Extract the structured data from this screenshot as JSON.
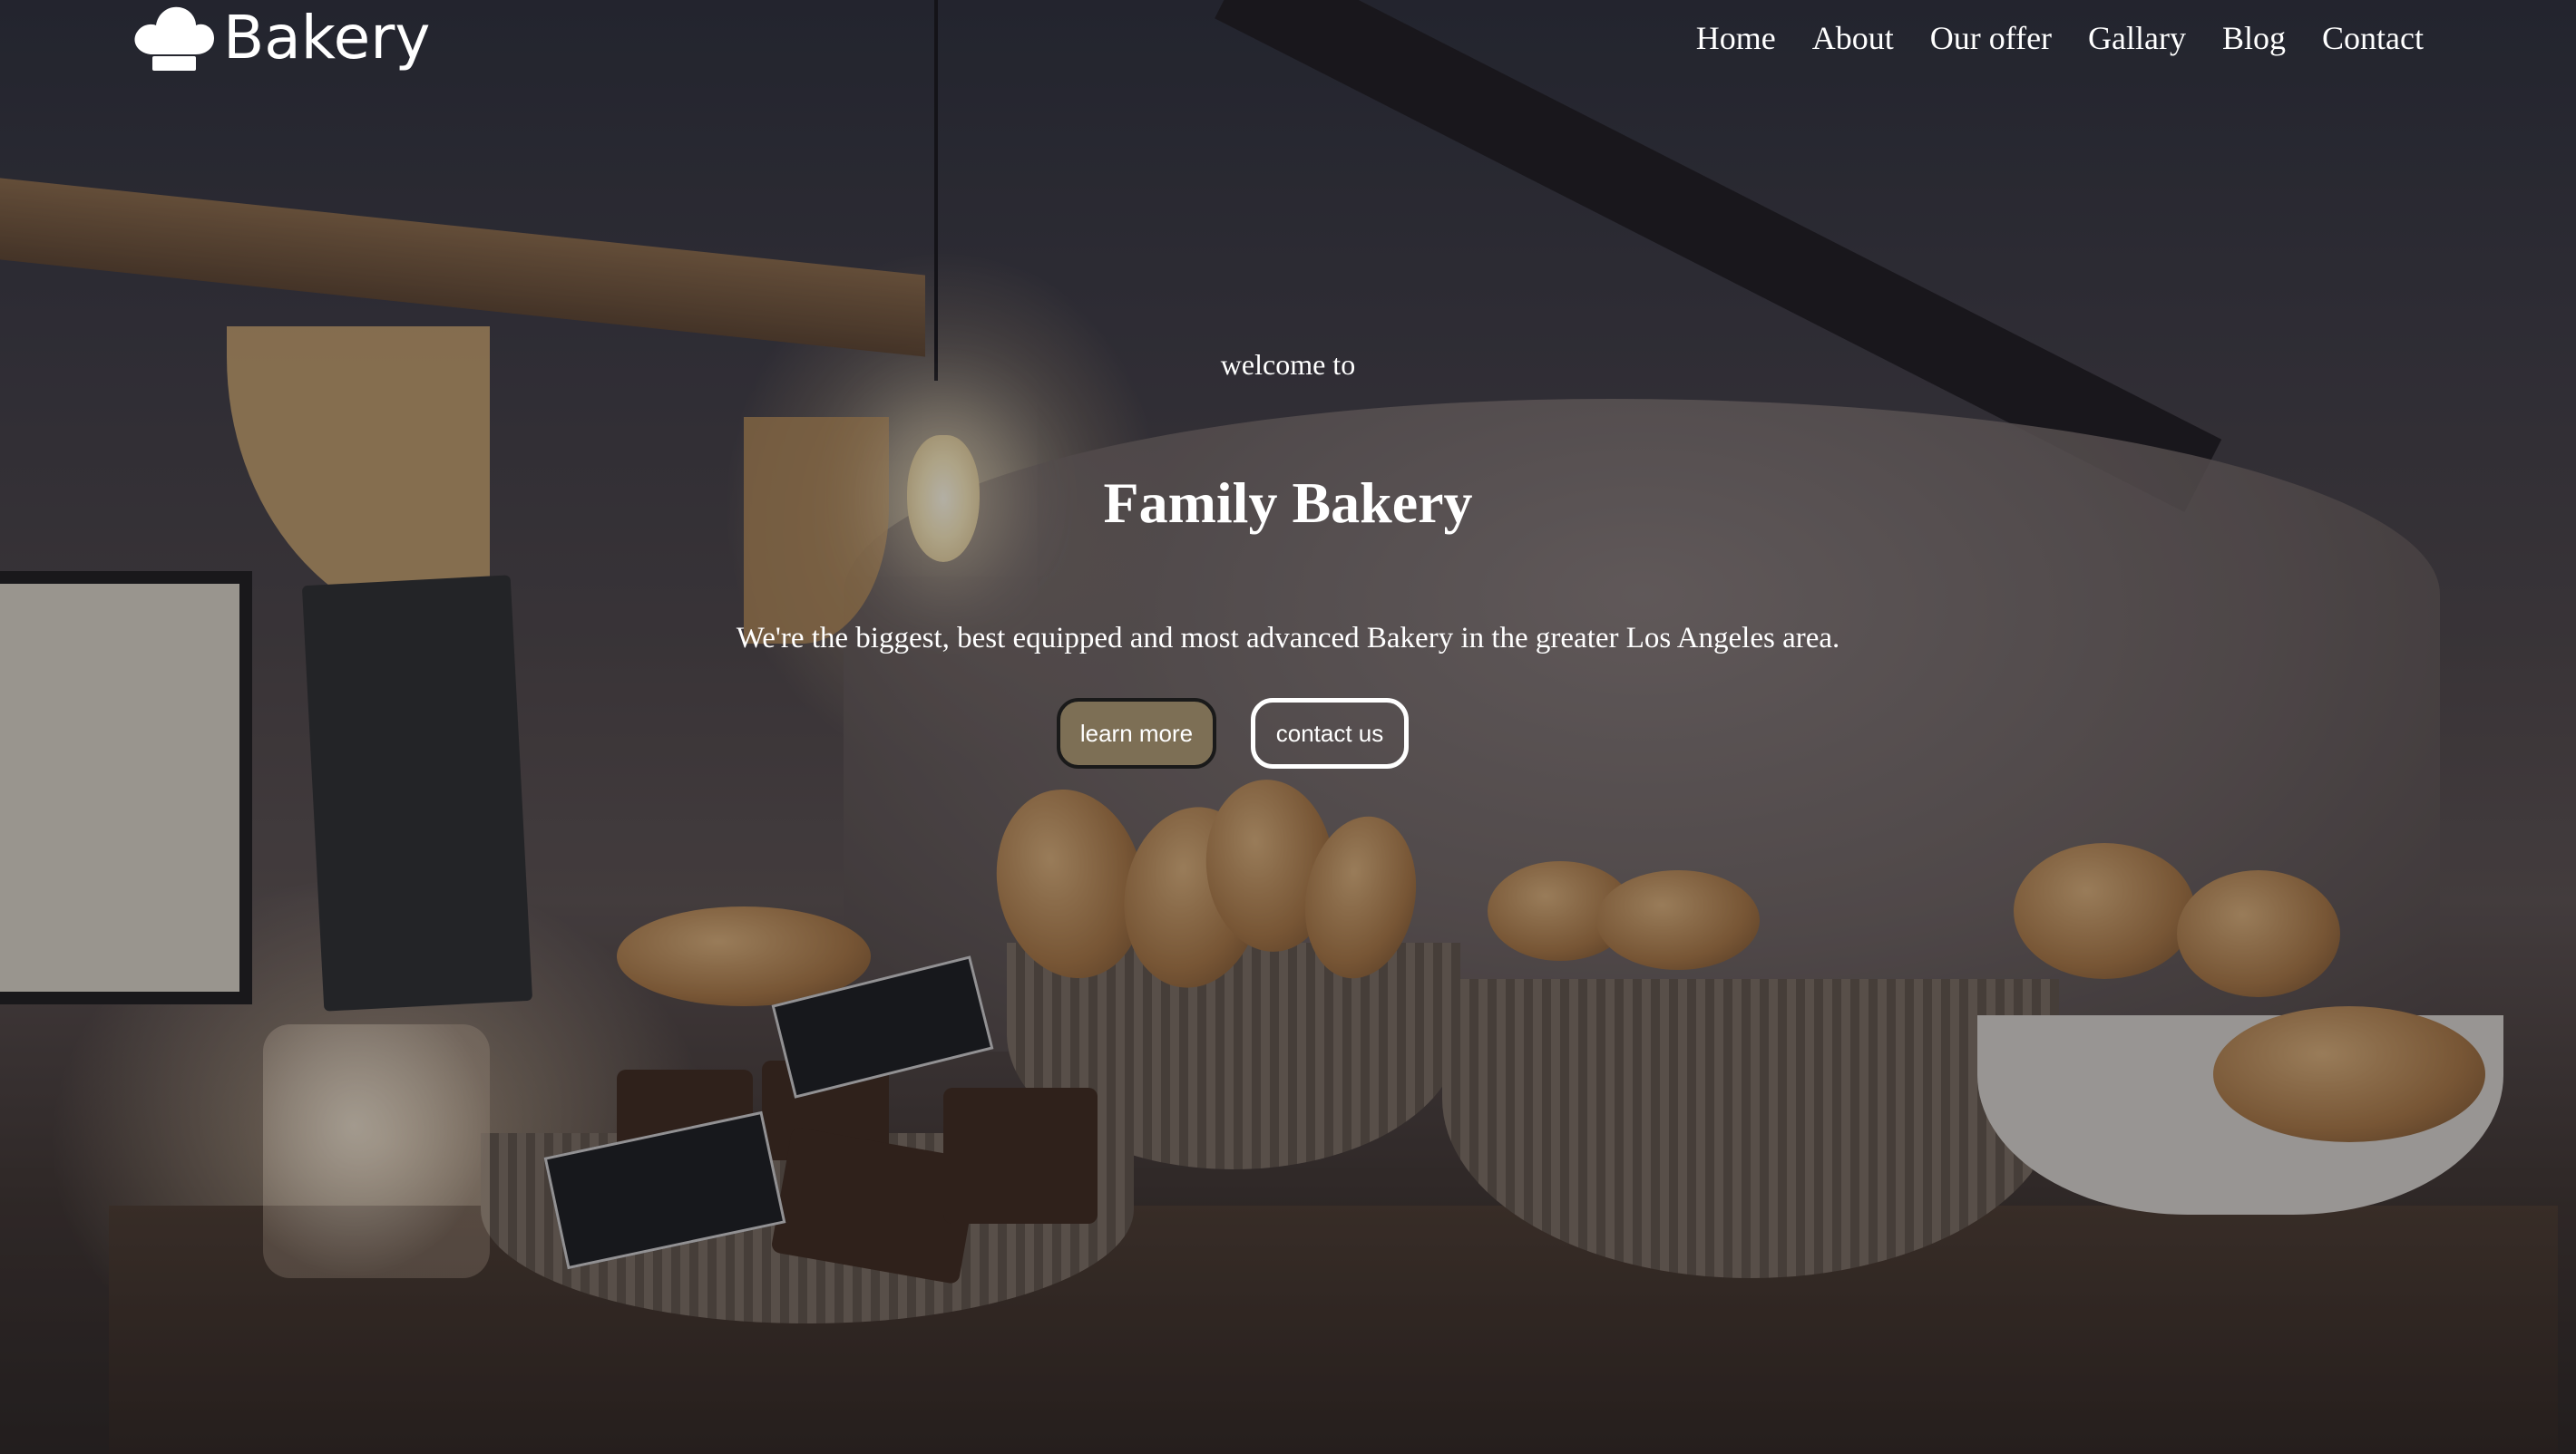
{
  "brand": {
    "name": "Bakery",
    "icon": "chef-hat-icon"
  },
  "nav": {
    "items": [
      {
        "label": "Home"
      },
      {
        "label": "About"
      },
      {
        "label": "Our offer"
      },
      {
        "label": "Gallary"
      },
      {
        "label": "Blog"
      },
      {
        "label": "Contact"
      }
    ]
  },
  "hero": {
    "welcome": "welcome to",
    "title": "Family Bakery",
    "subtitle": "We're the biggest, best equipped and most advanced Bakery in the greater Los Angeles area.",
    "learn_more_label": "learn more",
    "contact_label": "contact us"
  },
  "colors": {
    "learn_more_bg": "#7d6f55",
    "text": "#ffffff"
  }
}
